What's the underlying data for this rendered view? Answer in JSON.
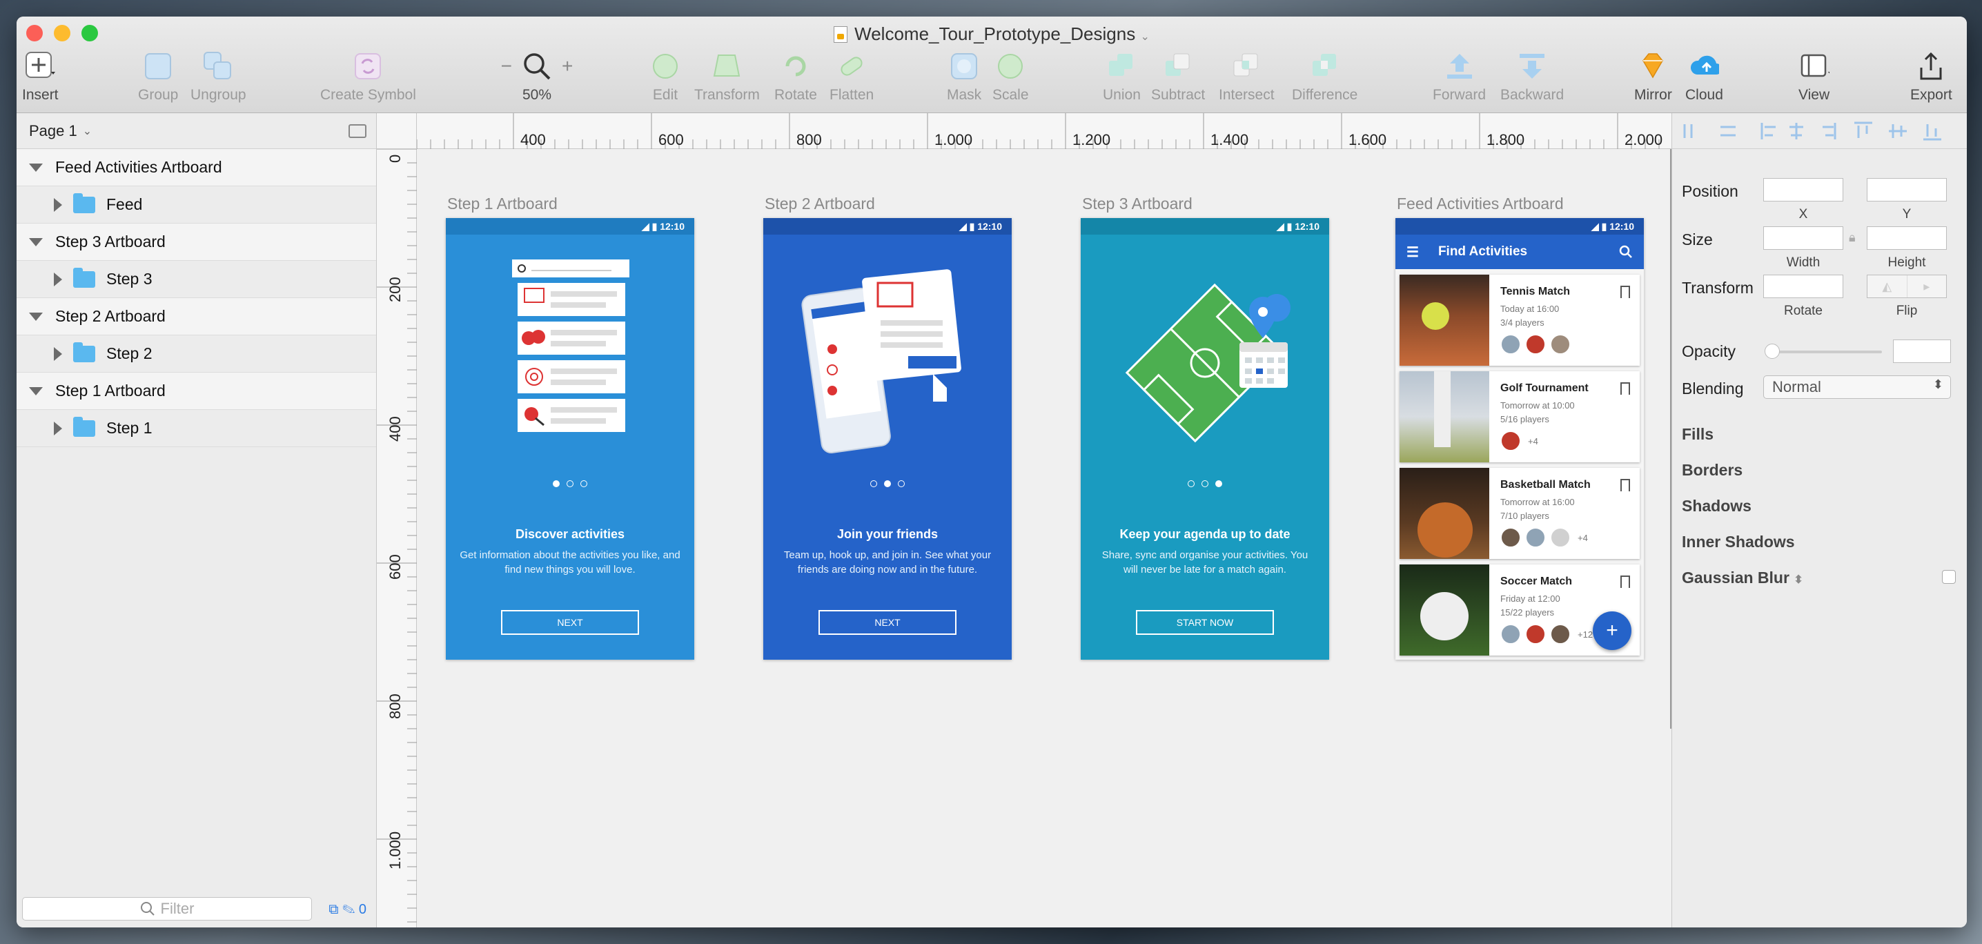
{
  "window": {
    "title": "Welcome_Tour_Prototype_Designs",
    "lights": [
      "#fc5f57",
      "#fdbb2e",
      "#2ac840"
    ]
  },
  "toolbar": {
    "insert": "Insert",
    "group": "Group",
    "ungroup": "Ungroup",
    "create_symbol": "Create Symbol",
    "zoom_minus": "−",
    "zoom_plus": "+",
    "zoom": "50%",
    "edit": "Edit",
    "transform": "Transform",
    "rotate": "Rotate",
    "flatten": "Flatten",
    "mask": "Mask",
    "scale": "Scale",
    "union": "Union",
    "subtract": "Subtract",
    "intersect": "Intersect",
    "difference": "Difference",
    "forward": "Forward",
    "backward": "Backward",
    "mirror": "Mirror",
    "cloud": "Cloud",
    "view": "View",
    "export": "Export"
  },
  "sidebar": {
    "page": "Page 1",
    "layers": [
      {
        "artboard": "Feed Activities Artboard",
        "child": "Feed"
      },
      {
        "artboard": "Step 3 Artboard",
        "child": "Step 3"
      },
      {
        "artboard": "Step 2 Artboard",
        "child": "Step 2"
      },
      {
        "artboard": "Step 1 Artboard",
        "child": "Step 1"
      }
    ],
    "filter_placeholder": "Filter",
    "filter_count": "0"
  },
  "rulers": {
    "top": [
      "400",
      "600",
      "800",
      "1.000",
      "1.200",
      "1.400",
      "1.600",
      "1.800",
      "2.000"
    ],
    "left": [
      "0",
      "200",
      "400",
      "600",
      "800",
      "1.000"
    ]
  },
  "artboards": {
    "step1": {
      "label": "Step 1 Artboard",
      "time": "12:10",
      "title": "Discover activities",
      "desc": "Get information about the activities you like, and find new things you will love.",
      "button": "NEXT",
      "color": "#2a8fd8"
    },
    "step2": {
      "label": "Step 2 Artboard",
      "time": "12:10",
      "title": "Join your friends",
      "desc": "Team up, hook up, and join in. See what your friends are doing now and in the future.",
      "button": "NEXT",
      "color": "#2563c9"
    },
    "step3": {
      "label": "Step 3 Artboard",
      "time": "12:10",
      "title": "Keep your agenda up to date",
      "desc": "Share, sync and organise your activities. You will never be late for a match again.",
      "button": "START NOW",
      "color": "#1a9bc0"
    },
    "feed": {
      "label": "Feed Activities Artboard",
      "time": "12:10",
      "header": "Find Activities",
      "cards": [
        {
          "name": "Tennis Match",
          "time": "Today at 16:00",
          "players": "3/4 players",
          "more": ""
        },
        {
          "name": "Golf Tournament",
          "time": "Tomorrow at 10:00",
          "players": "5/16 players",
          "more": "+4"
        },
        {
          "name": "Basketball Match",
          "time": "Tomorrow at 16:00",
          "players": "7/10 players",
          "more": "+4"
        },
        {
          "name": "Soccer Match",
          "time": "Friday at 12:00",
          "players": "15/22 players",
          "more": "+12"
        }
      ],
      "fab": "+"
    }
  },
  "inspector": {
    "position": "Position",
    "x": "X",
    "y": "Y",
    "size": "Size",
    "width": "Width",
    "height": "Height",
    "transform": "Transform",
    "rotate": "Rotate",
    "flip": "Flip",
    "opacity": "Opacity",
    "blending": "Blending",
    "blending_value": "Normal",
    "fills": "Fills",
    "borders": "Borders",
    "shadows": "Shadows",
    "inner_shadows": "Inner Shadows",
    "gaussian_blur": "Gaussian Blur"
  }
}
